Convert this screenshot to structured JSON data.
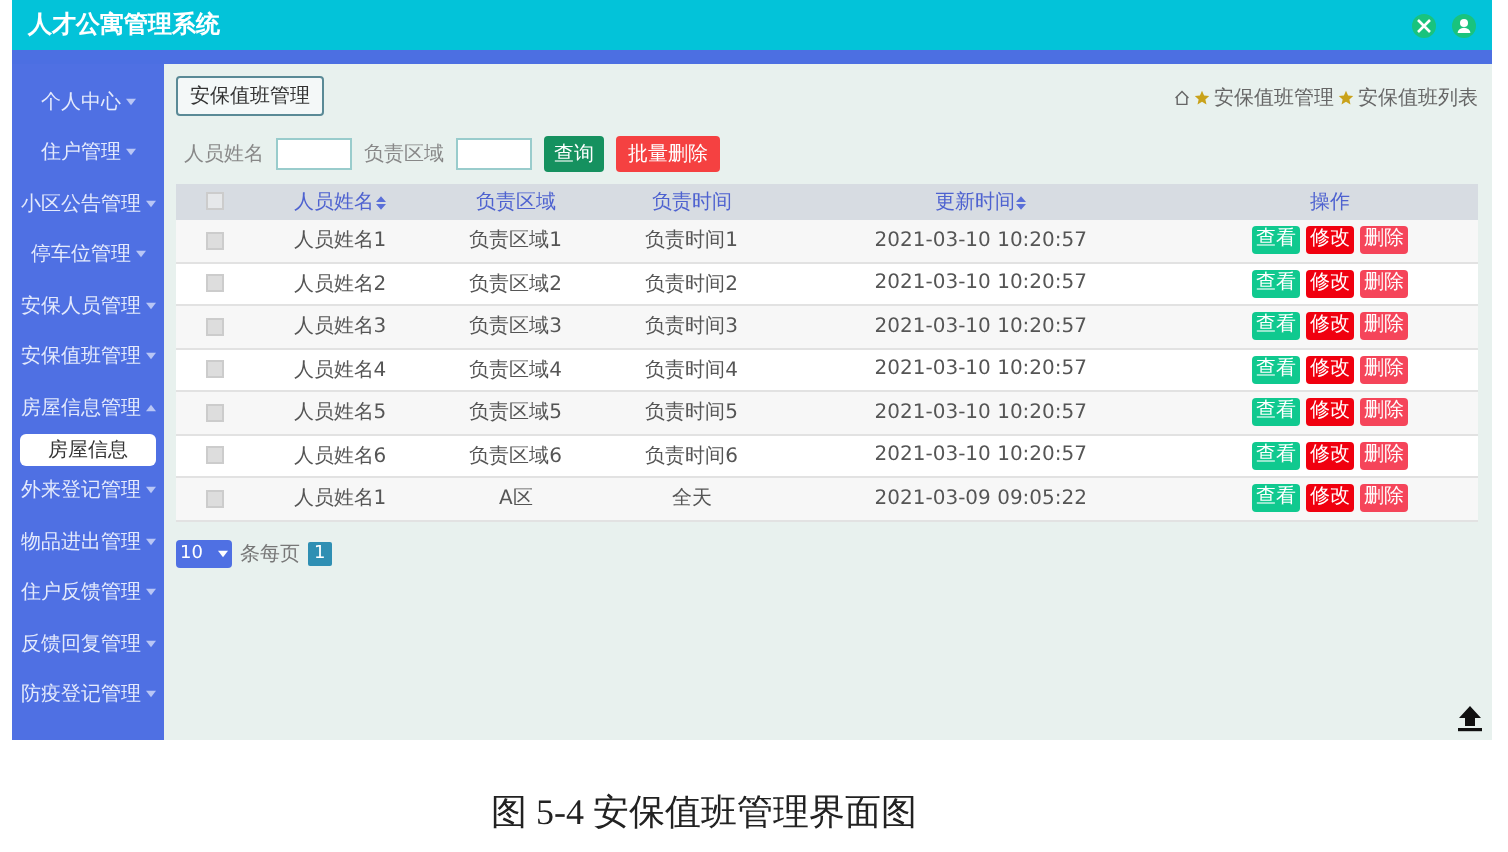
{
  "header": {
    "title": "人才公寓管理系统"
  },
  "sidebar": {
    "items": [
      {
        "label": "个人中心",
        "expanded": false
      },
      {
        "label": "住户管理",
        "expanded": false
      },
      {
        "label": "小区公告管理",
        "expanded": false
      },
      {
        "label": "停车位管理",
        "expanded": false
      },
      {
        "label": "安保人员管理",
        "expanded": false
      },
      {
        "label": "安保值班管理",
        "expanded": false
      },
      {
        "label": "房屋信息管理",
        "expanded": true,
        "children": [
          {
            "label": "房屋信息",
            "selected": true
          }
        ]
      },
      {
        "label": "外来登记管理",
        "expanded": false
      },
      {
        "label": "物品进出管理",
        "expanded": false
      },
      {
        "label": "住户反馈管理",
        "expanded": false
      },
      {
        "label": "反馈回复管理",
        "expanded": false
      },
      {
        "label": "防疫登记管理",
        "expanded": false
      }
    ]
  },
  "page_tab": "安保值班管理",
  "breadcrumb": [
    "安保值班管理",
    "安保值班列表"
  ],
  "search": {
    "fields": [
      {
        "label": "人员姓名"
      },
      {
        "label": "负责区域"
      }
    ],
    "query_button": "查询",
    "batch_delete_button": "批量删除"
  },
  "table": {
    "select_all_checked": false,
    "columns": [
      {
        "label": "人员姓名",
        "sortable": true
      },
      {
        "label": "负责区域",
        "sortable": false
      },
      {
        "label": "负责时间",
        "sortable": false
      },
      {
        "label": "更新时间",
        "sortable": true
      },
      {
        "label": "操作",
        "sortable": false
      }
    ],
    "rows": [
      {
        "checked": false,
        "cells": [
          "人员姓名1",
          "负责区域1",
          "负责时间1",
          "2021-03-10 10:20:57"
        ],
        "actions": [
          {
            "kind": "view",
            "label": "查看"
          },
          {
            "kind": "edit",
            "label": "修改"
          },
          {
            "kind": "delete",
            "label": "删除"
          }
        ]
      },
      {
        "checked": false,
        "cells": [
          "人员姓名2",
          "负责区域2",
          "负责时间2",
          "2021-03-10 10:20:57"
        ],
        "actions": [
          {
            "kind": "view",
            "label": "查看"
          },
          {
            "kind": "edit",
            "label": "修改"
          },
          {
            "kind": "delete",
            "label": "删除"
          }
        ]
      },
      {
        "checked": false,
        "cells": [
          "人员姓名3",
          "负责区域3",
          "负责时间3",
          "2021-03-10 10:20:57"
        ],
        "actions": [
          {
            "kind": "view",
            "label": "查看"
          },
          {
            "kind": "edit",
            "label": "修改"
          },
          {
            "kind": "delete",
            "label": "删除"
          }
        ]
      },
      {
        "checked": false,
        "cells": [
          "人员姓名4",
          "负责区域4",
          "负责时间4",
          "2021-03-10 10:20:57"
        ],
        "actions": [
          {
            "kind": "view",
            "label": "查看"
          },
          {
            "kind": "edit",
            "label": "修改"
          },
          {
            "kind": "delete",
            "label": "删除"
          }
        ]
      },
      {
        "checked": false,
        "cells": [
          "人员姓名5",
          "负责区域5",
          "负责时间5",
          "2021-03-10 10:20:57"
        ],
        "actions": [
          {
            "kind": "view",
            "label": "查看"
          },
          {
            "kind": "edit",
            "label": "修改"
          },
          {
            "kind": "delete",
            "label": "删除"
          }
        ]
      },
      {
        "checked": false,
        "cells": [
          "人员姓名6",
          "负责区域6",
          "负责时间6",
          "2021-03-10 10:20:57"
        ],
        "actions": [
          {
            "kind": "view",
            "label": "查看"
          },
          {
            "kind": "edit",
            "label": "修改"
          },
          {
            "kind": "delete",
            "label": "删除"
          }
        ]
      },
      {
        "checked": false,
        "cells": [
          "人员姓名1",
          "A区",
          "全天",
          "2021-03-09 09:05:22"
        ],
        "actions": [
          {
            "kind": "view",
            "label": "查看"
          },
          {
            "kind": "edit",
            "label": "修改"
          },
          {
            "kind": "delete",
            "label": "删除"
          }
        ]
      }
    ]
  },
  "pagination": {
    "page_size": "10",
    "page_size_label": "条每页",
    "pages": [
      {
        "label": "1",
        "selected": true
      }
    ]
  },
  "caption": "图 5-4 安保值班管理界面图"
}
